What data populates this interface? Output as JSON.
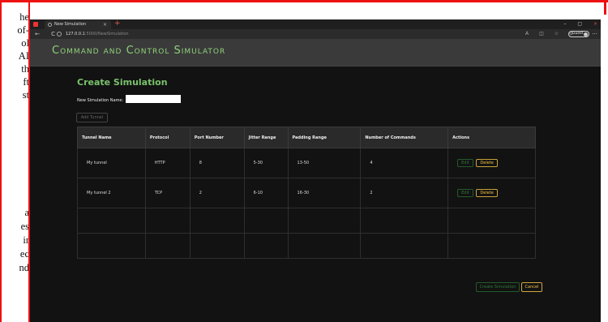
{
  "left_doc": {
    "lines": [
      "he",
      "of-",
      "ol",
      "AI",
      "th",
      "ft",
      "st",
      "a",
      "es",
      "ir",
      "ec",
      "nd"
    ]
  },
  "browser": {
    "tab_title": "New Simulation",
    "tab_close": "×",
    "new_tab": "+",
    "nav_buttons": "← C",
    "url_host": "127.0.0.1",
    "url_path": ":5000/NewSimulation",
    "guest_label": "Guest",
    "window_controls": [
      "–",
      "▢",
      "×"
    ],
    "more": "···"
  },
  "app": {
    "title": "Command and Control Simulator"
  },
  "page": {
    "heading": "Create Simulation",
    "name_label": "New Simulation Name:",
    "name_value": "",
    "add_tunnel_label": "Add Tunnel",
    "create_button": "Create Simulation",
    "cancel_button": "Cancel"
  },
  "table": {
    "headers": [
      "Tunnel Name",
      "Protocol",
      "Port Number",
      "Jitter Range",
      "Padding Range",
      "Number of Commands",
      "Actions"
    ],
    "rows": [
      {
        "name": "My tunnel",
        "protocol": "HTTP",
        "port": "8",
        "jitter": "5-30",
        "padding": "13-50",
        "commands": "4"
      },
      {
        "name": "My tunnel 2",
        "protocol": "TCP",
        "port": "2",
        "jitter": "6-10",
        "padding": "16-30",
        "commands": "2"
      }
    ],
    "edit_label": "Edit",
    "delete_label": "Delete"
  },
  "colors": {
    "accent_green": "#79c36b",
    "warning_yellow": "#f0c040",
    "frame_red": "#e11"
  }
}
